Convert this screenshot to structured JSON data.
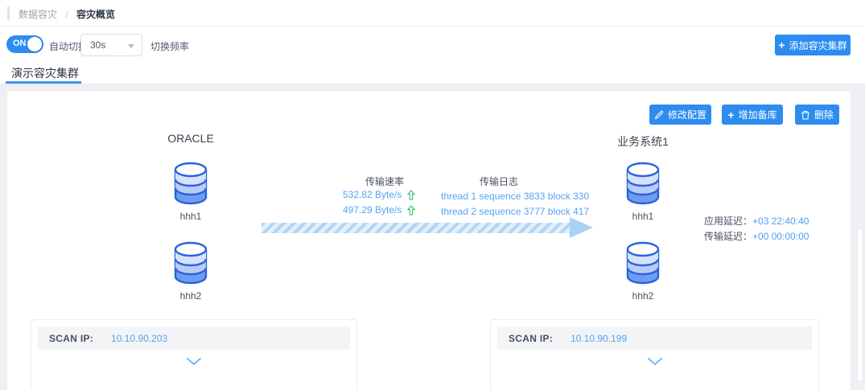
{
  "breadcrumb": {
    "parent": "数据容灾",
    "separator": "/",
    "current": "容灾概览"
  },
  "toolbar": {
    "toggle_text": "ON",
    "toggle_label": "自动切换",
    "interval_value": "30s",
    "interval_label": "切换频率",
    "plus": "+",
    "add_cluster_label": "添加容灾集群"
  },
  "tab": {
    "label": "演示容灾集群"
  },
  "card": {
    "actions": {
      "edit": "修改配置",
      "add_standby": "增加备库",
      "remove": "删除"
    },
    "primary": {
      "title": "ORACLE",
      "db1": "hhh1",
      "db2": "hhh2",
      "scan_label": "SCAN IP:",
      "scan_ip": "10.10.90.203"
    },
    "standby": {
      "title": "业务系统1",
      "db1": "hhh1",
      "db2": "hhh2",
      "scan_label": "SCAN IP:",
      "scan_ip": "10.10.90.199"
    },
    "transfer": {
      "rate_title": "传输速率",
      "rate1": "532.82 Byte/s",
      "rate2": "497.29 Byte/s",
      "log_title": "传输日志",
      "log1": "thread 1 sequence 3833 block 330",
      "log2": "thread 2 sequence 3777 block 417"
    },
    "latency": {
      "app_label": "应用延迟：",
      "app_value": "+03 22:40:40",
      "transfer_label": "传输延迟：",
      "transfer_value": "+00 00:00:00"
    }
  },
  "colors": {
    "primary": "#2d8cf0",
    "link": "#57a3f3",
    "success": "#19be6b"
  }
}
